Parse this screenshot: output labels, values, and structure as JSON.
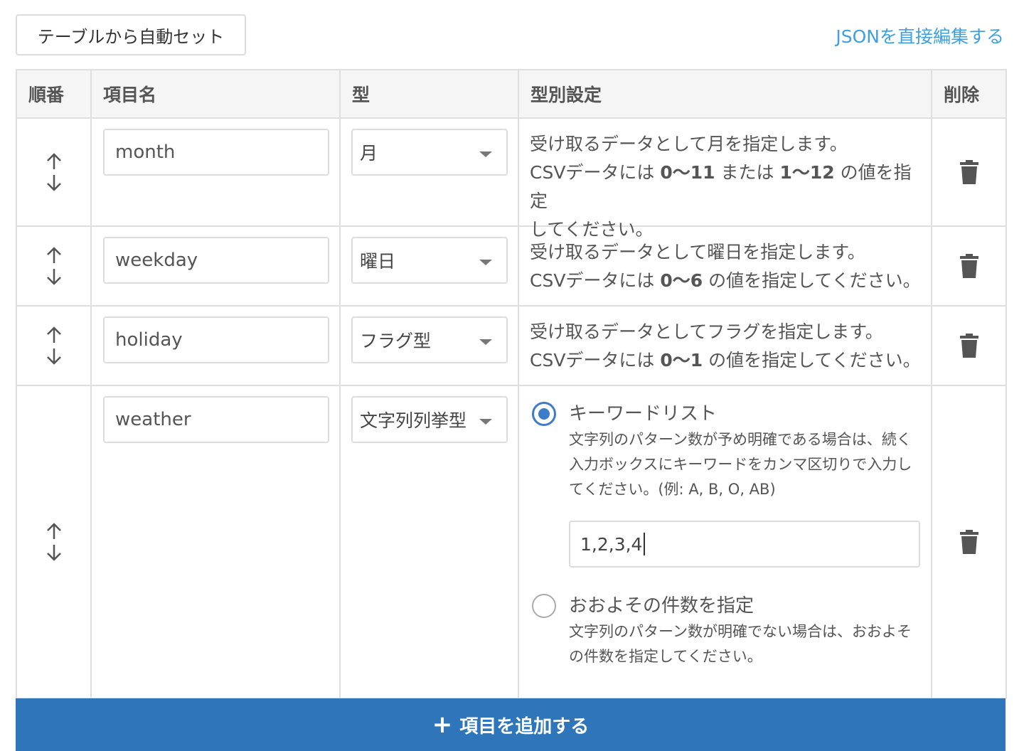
{
  "toolbar": {
    "auto_set_label": "テーブルから自動セット",
    "json_edit_label": "JSONを直接編集する"
  },
  "table": {
    "headers": [
      "順番",
      "項目名",
      "型",
      "型別設定",
      "削除"
    ],
    "rows": [
      {
        "name": "month",
        "type": "月",
        "detail_line1": "受け取るデータとして月を指定します。",
        "detail_line2_pre": "CSVデータには ",
        "detail_line2_b1": "0〜11",
        "detail_line2_mid": " または ",
        "detail_line2_b2": "1〜12",
        "detail_line2_post": " の値を指定",
        "detail_line3": "してください。"
      },
      {
        "name": "weekday",
        "type": "曜日",
        "detail_line1": "受け取るデータとして曜日を指定します。",
        "detail_line2_pre": "CSVデータには ",
        "detail_line2_b1": "0〜6",
        "detail_line2_post": " の値を指定してください。"
      },
      {
        "name": "holiday",
        "type": "フラグ型",
        "detail_line1": "受け取るデータとしてフラグを指定します。",
        "detail_line2_pre": "CSVデータには ",
        "detail_line2_b1": "0〜1",
        "detail_line2_post": " の値を指定してください。"
      },
      {
        "name": "weather",
        "type": "文字列列挙型",
        "options": [
          {
            "title": "キーワードリスト",
            "desc": "文字列のパターン数が予め明確である場合は、続く入力ボックスにキーワードをカンマ区切りで入力してください。(例: A, B, O, AB)",
            "selected": true
          },
          {
            "title": "おおよその件数を指定",
            "desc": "文字列のパターン数が明確でない場合は、おおよその件数を指定してください。",
            "selected": false
          }
        ],
        "keyword_value": "1,2,3,4"
      }
    ]
  },
  "add_button": {
    "icon": "+",
    "label": "項目を追加する"
  },
  "colors": {
    "accent_blue": "#2f75ba",
    "link_blue": "#3fa0e0",
    "radio_blue": "#3d7cc9"
  }
}
